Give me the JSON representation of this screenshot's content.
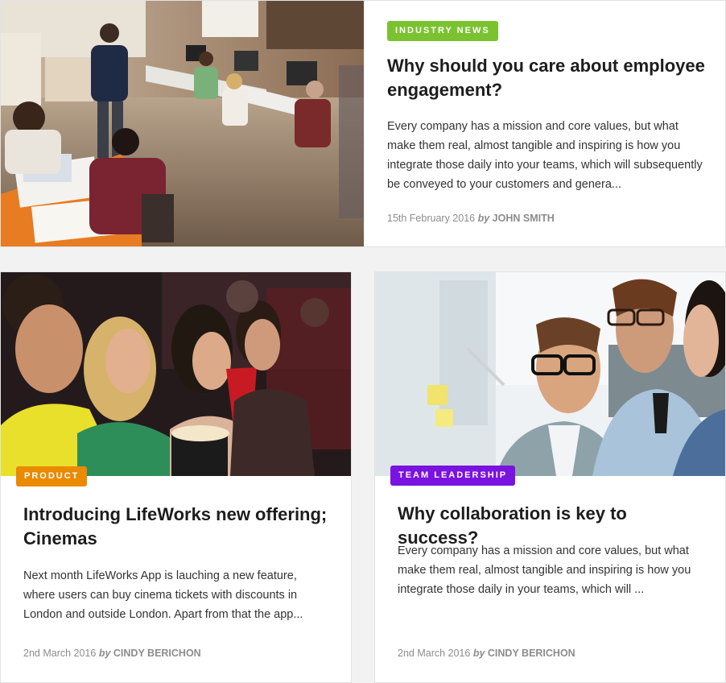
{
  "posts": [
    {
      "category": "Industry News",
      "category_color": "#7ac22f",
      "title": "Why should you care about employee engagement?",
      "excerpt": "Every company has a mission and core values, but what make them real, almost tangible and inspiring is how you integrate those daily into your teams, which will subsequently be conveyed to your customers and genera...",
      "date": "15th February 2016",
      "by": "by",
      "author": "John Smith",
      "image": "office-team-photo"
    },
    {
      "category": "Product",
      "category_color": "#e98a00",
      "title": "Introducing LifeWorks new offering; Cinemas",
      "excerpt": "Next month LifeWorks App is lauching a new feature, where users can buy cinema tickets with discounts in London and outside London. Apart from that the app...",
      "date": "2nd March 2016",
      "by": "by",
      "author": "Cindy Berichon",
      "image": "cinema-audience-photo"
    },
    {
      "category": "Team Leadership",
      "category_color": "#7a12e0",
      "title": "Why collaboration is key to success?",
      "excerpt": "Every company has a mission and core values, but what make them real, almost tangible and inspiring is how you integrate those daily in your teams, which will ...",
      "date": "2nd March 2016",
      "by": "by",
      "author": "Cindy Berichon",
      "image": "whiteboard-team-photo"
    }
  ]
}
